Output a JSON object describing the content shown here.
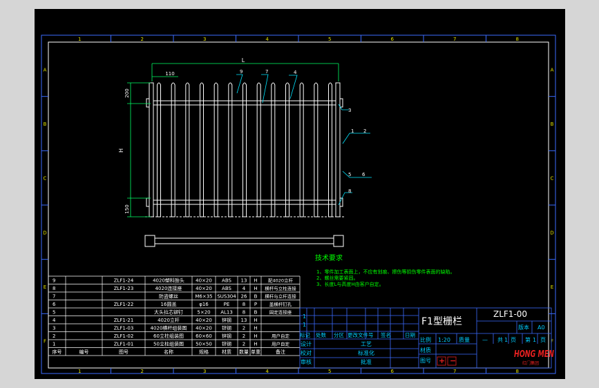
{
  "frame": {
    "col_labels": [
      "1",
      "2",
      "3",
      "4",
      "5",
      "6",
      "7",
      "8"
    ],
    "row_labels": [
      "A",
      "B",
      "C",
      "D",
      "E",
      "F"
    ]
  },
  "dims": {
    "L": "L",
    "d110": "110",
    "d200": "200",
    "dH": "H",
    "d150": "150"
  },
  "callouts": {
    "c9": "9",
    "c7": "7",
    "c4": "4",
    "c3": "3",
    "c1": "1",
    "c2": "2",
    "c5": "5",
    "c6": "6",
    "c8": "8"
  },
  "notes": {
    "title": "技术要求",
    "lines": [
      "1、零件加工表面上，不应有划痕、擦伤等损伤零件表面的缺陷。",
      "2、螺丝需要紧固。",
      "3、长度L与高度H由客户自定。"
    ]
  },
  "bom": {
    "headers": [
      "序号",
      "编号",
      "图号",
      "名称",
      "规格",
      "材质",
      "数量",
      "单重",
      "备注"
    ],
    "rows": [
      [
        "9",
        "",
        "ZLF1-24",
        "4020塑料胎头",
        "40×20",
        "ABS",
        "13",
        "H",
        "配4020立杆"
      ],
      [
        "8",
        "",
        "ZLF1-23",
        "4020连接座",
        "40×20",
        "ABS",
        "4",
        "H",
        "横杆与立柱连接"
      ],
      [
        "7",
        "",
        "",
        "防盗螺丝",
        "M6×35",
        "SUS304",
        "26",
        "B",
        "横杆与立杆连接"
      ],
      [
        "6",
        "",
        "ZLF1-22",
        "16圆盖",
        "φ16",
        "PE",
        "8",
        "P",
        "盖横杆钉孔"
      ],
      [
        "5",
        "",
        "",
        "大头拉芯铆钉",
        "5×20",
        "AL13",
        "8",
        "B",
        "固定连接座"
      ],
      [
        "4",
        "",
        "ZLF1-21",
        "4020立杆",
        "40×20",
        "锌钢",
        "13",
        "H",
        ""
      ],
      [
        "3",
        "",
        "ZLF1-03",
        "4020横杆组装图",
        "40×20",
        "锌钢",
        "2",
        "H",
        ""
      ],
      [
        "2",
        "",
        "ZLF1-02",
        "60立柱组装图",
        "60×60",
        "锌钢",
        "2",
        "H",
        "用户自定"
      ],
      [
        "1",
        "",
        "ZLF1-01",
        "50立柱组装图",
        "50×50",
        "锌钢",
        "2",
        "H",
        "用户自定"
      ]
    ]
  },
  "title_block": {
    "rev_headers": [
      "标记",
      "处数",
      "分区",
      "更改文件号",
      "签名",
      "日期"
    ],
    "rev_marks": [
      "1",
      "1"
    ],
    "title": "F1型栅栏",
    "drawing_no": "ZLF1-00",
    "version_label": "版本",
    "version": "A0",
    "design": "设计",
    "check": "校对",
    "review": "审核",
    "process": "工艺",
    "standard": "标准化",
    "approve": "批准",
    "scale_label": "比例",
    "scale": "1:20",
    "weight_label": "质量",
    "dash": "—",
    "total_label": "共",
    "total": "1",
    "page_unit": "页",
    "page_label": "第",
    "page": "1",
    "page_unit2": "页",
    "material_label": "材质",
    "drawing_label": "图号",
    "spec_label": "规格",
    "plus": "+",
    "minus": "−",
    "brand": "HONG MEN",
    "brand_sub": "红门集团"
  },
  "colors": {
    "line": "#ffffff",
    "dim": "#00ff66",
    "callout": "#00e5ff",
    "frame_label": "#e0e000",
    "note": "#00ff00",
    "title_block": "#00ccff",
    "bom_line": "#ffffff",
    "brand": "#e62020"
  }
}
